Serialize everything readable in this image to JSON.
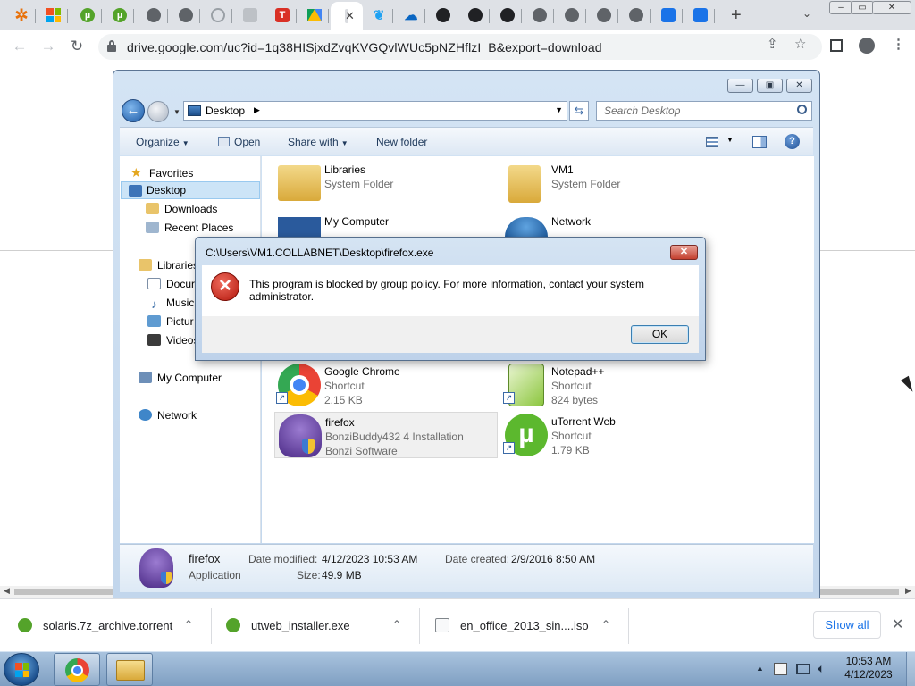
{
  "browser": {
    "url": "drive.google.com/uc?id=1q38HISjxdZvqKVGQvlWUc5pNZHflzI_B&export=download",
    "tab_close_glyph": "✕",
    "new_tab_glyph": "+",
    "tab_list_glyph": "⌄",
    "tabs": [
      {
        "icon": "settings-gear-icon",
        "color": "#e8710a"
      },
      {
        "icon": "windows-icon",
        "color": "#0078d4"
      },
      {
        "icon": "utorrent-icon",
        "color": "#54a32a"
      },
      {
        "icon": "utorrent-icon",
        "color": "#54a32a"
      },
      {
        "icon": "globe-icon",
        "color": "#5f6368"
      },
      {
        "icon": "globe-icon",
        "color": "#5f6368"
      },
      {
        "icon": "search-person-icon",
        "color": "#9aa0a6"
      },
      {
        "icon": "figure-icon",
        "color": "#9aa0a6"
      },
      {
        "icon": "t-logo-icon",
        "color": "#d93025"
      },
      {
        "icon": "google-drive-icon",
        "color": "#fbbc04"
      },
      {
        "icon": "drive-active-icon",
        "color": "#dadce0"
      },
      {
        "icon": "twitter-icon",
        "color": "#1da1f2"
      },
      {
        "icon": "cloud-icon",
        "color": "#0a66c2"
      },
      {
        "icon": "github-icon",
        "color": "#202124"
      },
      {
        "icon": "github-icon",
        "color": "#202124"
      },
      {
        "icon": "github-icon",
        "color": "#202124"
      },
      {
        "icon": "globe-icon",
        "color": "#5f6368"
      },
      {
        "icon": "globe-icon",
        "color": "#5f6368"
      },
      {
        "icon": "globe-icon",
        "color": "#5f6368"
      },
      {
        "icon": "globe-icon",
        "color": "#5f6368"
      },
      {
        "icon": "app-icon",
        "color": "#1a73e8"
      },
      {
        "icon": "app-icon",
        "color": "#1a73e8"
      }
    ]
  },
  "explorer": {
    "address": "Desktop",
    "search_placeholder": "Search Desktop",
    "toolbar": {
      "organize": "Organize",
      "open": "Open",
      "share_with": "Share with",
      "new_folder": "New folder",
      "help": "?"
    },
    "nav": {
      "favorites": "Favorites",
      "desktop": "Desktop",
      "downloads": "Downloads",
      "recent_places": "Recent Places",
      "libraries": "Libraries",
      "documents": "Docur",
      "music": "Music",
      "pictures": "Pictur",
      "videos": "Videos",
      "my_computer": "My Computer",
      "network": "Network"
    },
    "items": {
      "libraries": {
        "name": "Libraries",
        "type": "System Folder"
      },
      "vm1": {
        "name": "VM1",
        "type": "System Folder"
      },
      "my_computer": {
        "name": "My Computer"
      },
      "network": {
        "name": "Network"
      },
      "chrome": {
        "name": "Google Chrome",
        "type": "Shortcut",
        "size": "2.15 KB"
      },
      "notepad": {
        "name": "Notepad++",
        "type": "Shortcut",
        "size": "824 bytes"
      },
      "firefox": {
        "name": "firefox",
        "desc": "BonziBuddy432 4 Installation",
        "company": "Bonzi Software"
      },
      "utorrent": {
        "name": "uTorrent Web",
        "type": "Shortcut",
        "size": "1.79 KB"
      }
    },
    "details": {
      "name": "firefox",
      "type": "Application",
      "date_modified_label": "Date modified:",
      "date_modified": "4/12/2023 10:53 AM",
      "size_label": "Size:",
      "size": "49.9 MB",
      "date_created_label": "Date created:",
      "date_created": "2/9/2016 8:50 AM"
    }
  },
  "dialog": {
    "title": "C:\\Users\\VM1.COLLABNET\\Desktop\\firefox.exe",
    "message": "This program is blocked by group policy. For more information, contact your system administrator.",
    "ok": "OK",
    "close_glyph": "✕"
  },
  "downloads": {
    "items": [
      {
        "name": "solaris.7z_archive.torrent",
        "icon": "utorrent-icon"
      },
      {
        "name": "utweb_installer.exe",
        "icon": "utorrent-icon"
      },
      {
        "name": "en_office_2013_sin....iso",
        "icon": "file-icon"
      }
    ],
    "show_all": "Show all",
    "close_glyph": "✕"
  },
  "taskbar": {
    "time": "10:53 AM",
    "date": "4/12/2023",
    "tray_up_glyph": "▲"
  }
}
